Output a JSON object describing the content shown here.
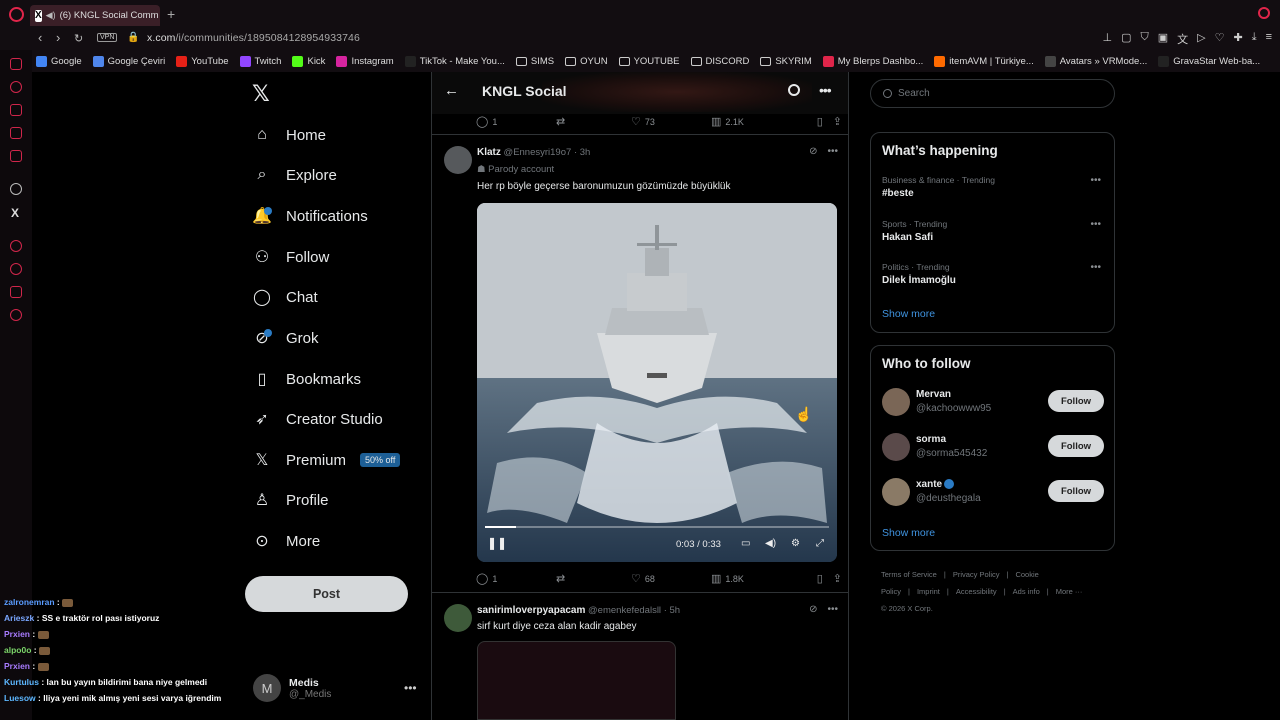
{
  "browser": {
    "tab_title": "(6) KNGL Social Comm",
    "url_host": "x.com",
    "url_path": "/i/communities/1895084128954933746",
    "vpn_label": "VPN",
    "bookmarks": [
      {
        "label": "Google",
        "color": "#4285f4"
      },
      {
        "label": "Google Çeviri",
        "color": "#4f86ec"
      },
      {
        "label": "YouTube",
        "color": "#e62117"
      },
      {
        "label": "Twitch",
        "color": "#9146ff"
      },
      {
        "label": "Kick",
        "color": "#53fc18"
      },
      {
        "label": "Instagram",
        "color": "#d6249f"
      },
      {
        "label": "TikTok - Make You...",
        "color": "#222222"
      },
      {
        "label": "SIMS",
        "color": "folder"
      },
      {
        "label": "OYUN",
        "color": "folder"
      },
      {
        "label": "YOUTUBE",
        "color": "folder"
      },
      {
        "label": "DISCORD",
        "color": "folder"
      },
      {
        "label": "SKYRIM",
        "color": "folder"
      },
      {
        "label": "My Blerps Dashbo...",
        "color": "#e0254a"
      },
      {
        "label": "itemAVM | Türkiye...",
        "color": "#ff6a00"
      },
      {
        "label": "Avatars » VRMode...",
        "color": "#444444"
      },
      {
        "label": "GravaStar Web-ba...",
        "color": "#222222"
      }
    ]
  },
  "nav": {
    "items": [
      {
        "label": "Home",
        "icon": "home-icon"
      },
      {
        "label": "Explore",
        "icon": "search-icon"
      },
      {
        "label": "Notifications",
        "icon": "bell-icon"
      },
      {
        "label": "Follow",
        "icon": "person-plus-icon"
      },
      {
        "label": "Chat",
        "icon": "chat-icon"
      },
      {
        "label": "Grok",
        "icon": "grok-icon"
      },
      {
        "label": "Bookmarks",
        "icon": "bookmark-icon"
      },
      {
        "label": "Creator Studio",
        "icon": "rocket-icon"
      },
      {
        "label": "Premium",
        "icon": "x-icon"
      },
      {
        "label": "Profile",
        "icon": "person-icon"
      },
      {
        "label": "More",
        "icon": "more-circle-icon"
      }
    ],
    "premium_badge": "50% off",
    "post_button": "Post",
    "account": {
      "name": "Medis",
      "handle": "@_Medis",
      "initial": "M"
    }
  },
  "chat_overlay": [
    {
      "user": "zalronemran",
      "msg": ""
    },
    {
      "user": "Arieszk",
      "msg": "SS e traktör rol pası istiyoruz"
    },
    {
      "user": "Prxien",
      "msg": ""
    },
    {
      "user": "alpo0o",
      "msg": ""
    },
    {
      "user": "Prxien",
      "msg": ""
    },
    {
      "user": "Kurtulus",
      "msg": "lan bu yayın bildirimi bana niye gelmedi"
    },
    {
      "user": "Luesow",
      "msg": "lliya yeni mik almış yeni sesi varya iğrendim"
    }
  ],
  "community": {
    "title": "KNGL Social"
  },
  "prev_post_stats": {
    "replies": "1",
    "likes": "73",
    "views": "2.1K"
  },
  "post1": {
    "name": "Klatz",
    "handle": "@Ennesyri19o7",
    "time": "· 3h",
    "label": "Parody account",
    "text": "Her rp böyle geçerse baronumuzun gözümüzde büyüklük",
    "video_time": "0:03 / 0:33",
    "progress": 0.09,
    "stats": {
      "replies": "1",
      "likes": "68",
      "views": "1.8K"
    }
  },
  "post2": {
    "name": "sanirimloverpyapacam",
    "handle": "@emenkefedalsll",
    "time": "· 5h",
    "text": "sirf kurt diye ceza alan kadir agabey"
  },
  "right": {
    "search_placeholder": "Search",
    "happening_title": "What’s happening",
    "trends": [
      {
        "context": "Business & finance · Trending",
        "name": "#beste"
      },
      {
        "context": "Sports · Trending",
        "name": "Hakan Safi"
      },
      {
        "context": "Politics · Trending",
        "name": "Dilek İmamoğlu"
      }
    ],
    "show_more": "Show more",
    "wtf_title": "Who to follow",
    "wtf": [
      {
        "name": "Mervan",
        "handle": "@kachoowww95",
        "verified": false
      },
      {
        "name": "sorma",
        "handle": "@sorma545432",
        "verified": false
      },
      {
        "name": "xante",
        "handle": "@deusthegala",
        "verified": true
      }
    ],
    "follow_label": "Follow",
    "footer": [
      "Terms of Service",
      "|",
      "Privacy Policy",
      "|",
      "Cookie Policy",
      "|",
      "Imprint",
      "|",
      "Accessibility",
      "|",
      "Ads info",
      "|",
      "More ···",
      "© 2026 X Corp."
    ]
  }
}
